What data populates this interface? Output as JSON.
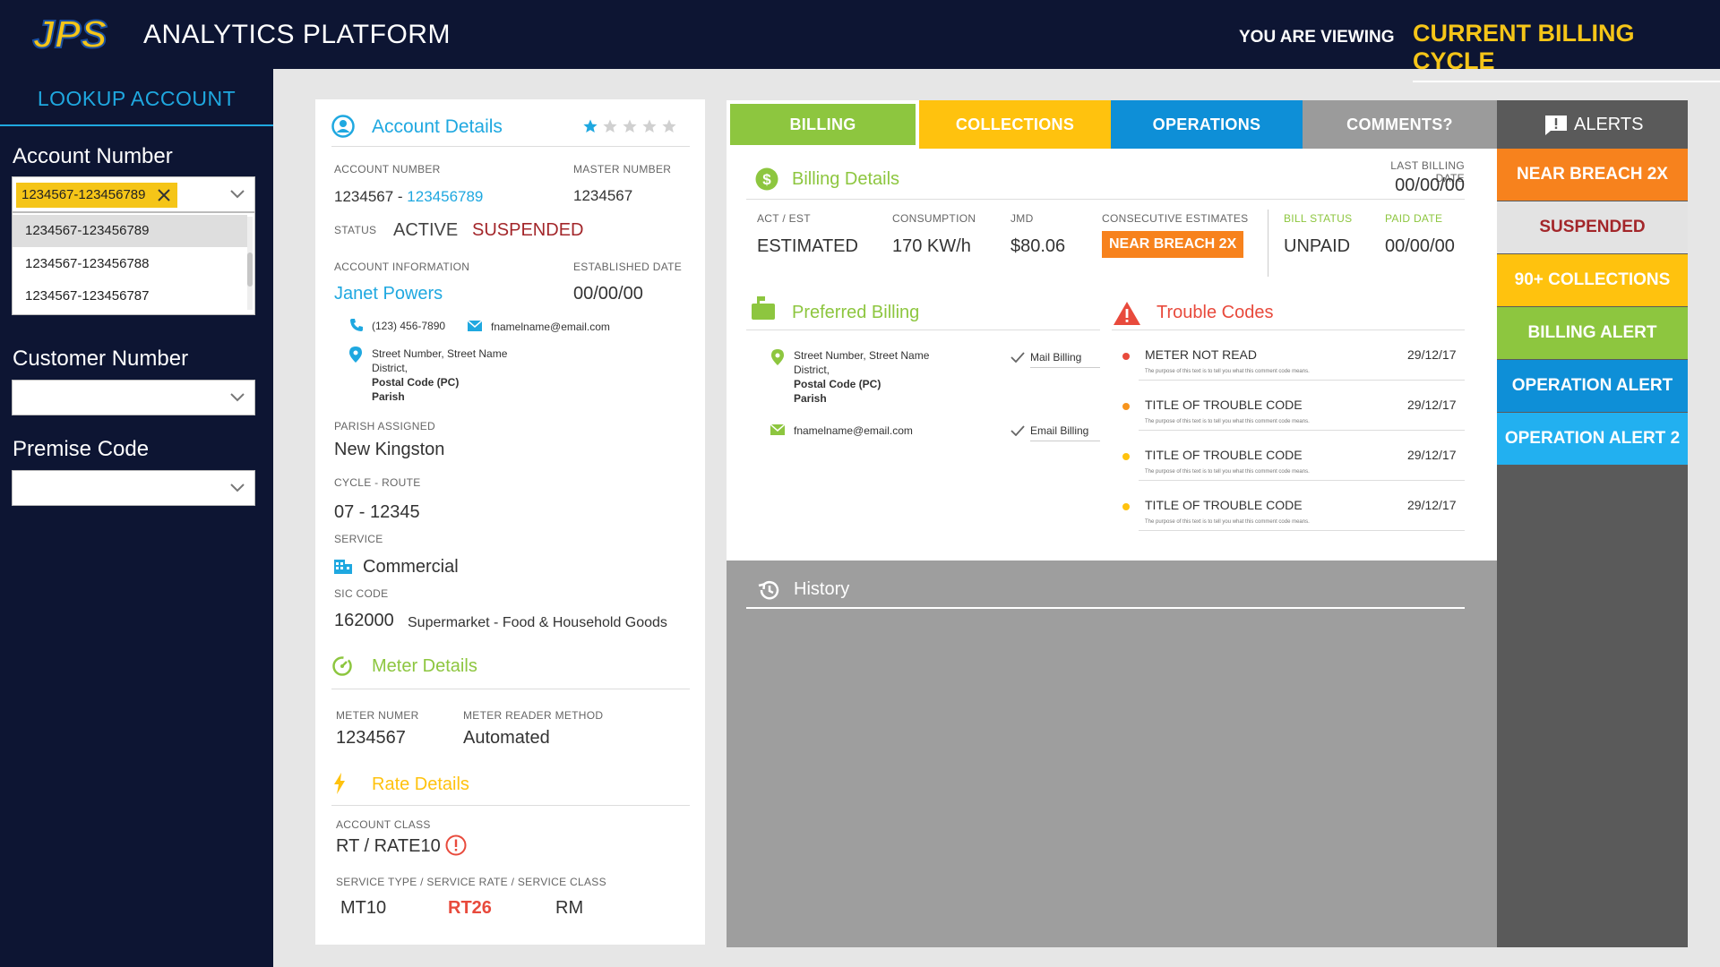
{
  "header": {
    "logo_text": "JPS",
    "app_title": "ANALYTICS PLATFORM",
    "viewing_label": "YOU ARE VIEWING",
    "viewing_value": "CURRENT BILLING CYCLE"
  },
  "sidebar": {
    "title": "LOOKUP ACCOUNT",
    "account_number_label": "Account Number",
    "account_selected": "1234567-123456789",
    "account_options": [
      "1234567-123456789",
      "1234567-123456788",
      "1234567-123456787"
    ],
    "customer_number_label": "Customer Number",
    "premise_code_label": "Premise Code"
  },
  "account": {
    "title": "Account Details",
    "rating": 1,
    "rating_max": 5,
    "account_number_label": "ACCOUNT NUMBER",
    "account_number_prefix": "1234567 - ",
    "account_number_link": "123456789",
    "master_number_label": "MASTER NUMBER",
    "master_number": "1234567",
    "status_label": "STATUS",
    "status_active": "ACTIVE",
    "status_suspended": "SUSPENDED",
    "info_label": "ACCOUNT INFORMATION",
    "established_label": "ESTABLISHED DATE",
    "name": "Janet Powers",
    "established_date": "00/00/00",
    "phone": "(123) 456-7890",
    "email": "fnamelname@email.com",
    "address_line1": "Street Number, Street Name",
    "address_line2": "District,",
    "address_line3": "Postal Code (PC)",
    "address_line4": "Parish",
    "parish_label": "PARISH ASSIGNED",
    "parish": "New Kingston",
    "cycle_label": "CYCLE - ROUTE",
    "cycle": "07 - 12345",
    "service_label": "SERVICE",
    "service": "Commercial",
    "sic_label": "SIC CODE",
    "sic_code": "162000",
    "sic_desc": "Supermarket - Food & Household Goods"
  },
  "meter": {
    "title": "Meter Details",
    "number_label": "METER NUMER",
    "number": "1234567",
    "method_label": "METER READER METHOD",
    "method": "Automated"
  },
  "rate": {
    "title": "Rate Details",
    "class_label": "ACCOUNT CLASS",
    "class": "RT / RATE10",
    "service_label": "SERVICE TYPE / SERVICE RATE / SERVICE CLASS",
    "type": "MT10",
    "rate": "RT26",
    "service_class": "RM"
  },
  "tabs": [
    {
      "label": "BILLING",
      "color": "#8dc63f"
    },
    {
      "label": "COLLECTIONS",
      "color": "#ffc20e"
    },
    {
      "label": "OPERATIONS",
      "color": "#0e8fd7"
    },
    {
      "label": "COMMENTS?",
      "color": "#9b9b9b"
    }
  ],
  "billing": {
    "title": "Billing Details",
    "last_billing_label": "LAST BILLING DATE",
    "last_billing_date": "00/00/00",
    "act_label": "ACT / EST",
    "act": "ESTIMATED",
    "consumption_label": "CONSUMPTION",
    "consumption": "170 KW/h",
    "jmd_label": "JMD",
    "jmd": "$80.06",
    "consec_label": "CONSECUTIVE ESTIMATES",
    "consec": "NEAR BREACH 2X",
    "bill_status_label": "BILL STATUS",
    "bill_status": "UNPAID",
    "paid_label": "PAID DATE",
    "paid": "00/00/00"
  },
  "preferred": {
    "title": "Preferred Billing",
    "address_line1": "Street Number, Street Name",
    "address_line2": "District,",
    "address_line3": "Postal Code (PC)",
    "address_line4": "Parish",
    "mail_label": "Mail Billing",
    "email": "fnamelname@email.com",
    "email_label": "Email Billing"
  },
  "trouble": {
    "title": "Trouble Codes",
    "items": [
      {
        "title": "METER NOT READ",
        "date": "29/12/17",
        "desc": "The purpose of this text is to tell you what this comment code means.",
        "color": "#e84a3c"
      },
      {
        "title": "TITLE OF TROUBLE CODE",
        "date": "29/12/17",
        "desc": "The purpose of this text is to tell you what this comment code means.",
        "color": "#f7941d"
      },
      {
        "title": "TITLE OF TROUBLE CODE",
        "date": "29/12/17",
        "desc": "The purpose of this text is to tell you what this comment code means.",
        "color": "#ffc20e"
      },
      {
        "title": "TITLE OF TROUBLE CODE",
        "date": "29/12/17",
        "desc": "The purpose of this text is to tell you what this comment code means.",
        "color": "#ffc20e"
      }
    ]
  },
  "history": {
    "title": "History"
  },
  "alerts": {
    "title": "ALERTS",
    "items": [
      {
        "label": "NEAR BREACH 2X",
        "bg": "#f7821d",
        "fg": "#ffffff"
      },
      {
        "label": "SUSPENDED",
        "bg": "#e3e3e3",
        "fg": "#a3262a"
      },
      {
        "label": "90+ COLLECTIONS",
        "bg": "#ffc20e",
        "fg": "#ffffff"
      },
      {
        "label": "BILLING ALERT",
        "bg": "#8dc63f",
        "fg": "#ffffff"
      },
      {
        "label": "OPERATION ALERT",
        "bg": "#0e8fd7",
        "fg": "#ffffff"
      },
      {
        "label": "OPERATION ALERT 2",
        "bg": "#22b0f0",
        "fg": "#ffffff"
      }
    ]
  }
}
